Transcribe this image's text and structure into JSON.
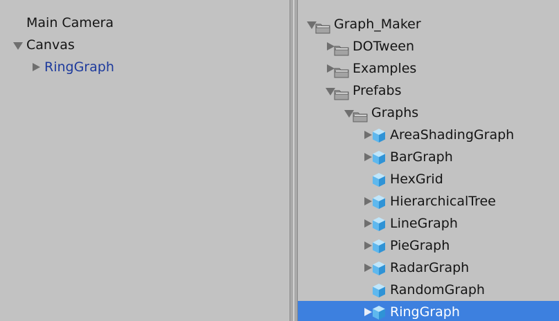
{
  "hierarchy": {
    "items": [
      {
        "label": "Main Camera",
        "depth": 0,
        "foldout": "none",
        "style": "normal"
      },
      {
        "label": "Canvas",
        "depth": 0,
        "foldout": "open",
        "style": "normal"
      },
      {
        "label": "RingGraph",
        "depth": 1,
        "foldout": "closed",
        "style": "prefab"
      }
    ]
  },
  "project": {
    "items": [
      {
        "label": "Graph_Maker",
        "depth": 0,
        "type": "folder",
        "foldout": "open",
        "selected": false
      },
      {
        "label": "DOTween",
        "depth": 1,
        "type": "folder",
        "foldout": "closed",
        "selected": false
      },
      {
        "label": "Examples",
        "depth": 1,
        "type": "folder",
        "foldout": "closed",
        "selected": false
      },
      {
        "label": "Prefabs",
        "depth": 1,
        "type": "folder",
        "foldout": "open",
        "selected": false
      },
      {
        "label": "Graphs",
        "depth": 2,
        "type": "folder",
        "foldout": "open",
        "selected": false
      },
      {
        "label": "AreaShadingGraph",
        "depth": 3,
        "type": "prefab",
        "foldout": "closed",
        "selected": false
      },
      {
        "label": "BarGraph",
        "depth": 3,
        "type": "prefab",
        "foldout": "closed",
        "selected": false
      },
      {
        "label": "HexGrid",
        "depth": 3,
        "type": "prefab",
        "foldout": "none",
        "selected": false
      },
      {
        "label": "HierarchicalTree",
        "depth": 3,
        "type": "prefab",
        "foldout": "closed",
        "selected": false
      },
      {
        "label": "LineGraph",
        "depth": 3,
        "type": "prefab",
        "foldout": "closed",
        "selected": false
      },
      {
        "label": "PieGraph",
        "depth": 3,
        "type": "prefab",
        "foldout": "closed",
        "selected": false
      },
      {
        "label": "RadarGraph",
        "depth": 3,
        "type": "prefab",
        "foldout": "closed",
        "selected": false
      },
      {
        "label": "RandomGraph",
        "depth": 3,
        "type": "prefab",
        "foldout": "none",
        "selected": false
      },
      {
        "label": "RingGraph",
        "depth": 3,
        "type": "prefab",
        "foldout": "closed",
        "selected": true
      }
    ]
  },
  "colors": {
    "background": "#c2c2c2",
    "selection": "#3d80df",
    "prefab_text": "#1d3a9c",
    "text": "#141414"
  }
}
